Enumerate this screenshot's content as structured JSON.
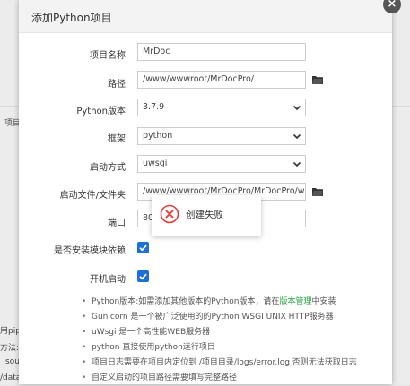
{
  "background": {
    "left_texts": [
      "项目",
      "用pip",
      "方法:",
      "sou",
      "/data"
    ]
  },
  "modal": {
    "title": "添加Python项目",
    "close_icon": "close-icon"
  },
  "form": {
    "project_name": {
      "label": "项目名称",
      "value": "MrDoc"
    },
    "path": {
      "label": "路径",
      "value": "/www/wwwroot/MrDocPro/"
    },
    "python_version": {
      "label": "Python版本",
      "value": "3.7.9"
    },
    "framework": {
      "label": "框架",
      "value": "python"
    },
    "start_method": {
      "label": "启动方式",
      "value": "uwsgi"
    },
    "start_file": {
      "label": "启动文件/文件夹",
      "value": "/www/wwwroot/MrDocPro/MrDocPro/wsgi.py"
    },
    "port": {
      "label": "端口",
      "value": "80"
    },
    "install_modules": {
      "label": "是否安装模块依赖",
      "checked": true
    },
    "autostart": {
      "label": "开机启动",
      "checked": true
    }
  },
  "tips": [
    {
      "before": "Python版本:如需添加其他版本的Python版本，请在",
      "link": "版本管理",
      "after": "中安装"
    },
    {
      "before": "Gunicorn 是一个被广泛使用的的Python WSGI UNIX HTTP服务器",
      "link": "",
      "after": ""
    },
    {
      "before": "uWsgi 是一个高性能WEB服务器",
      "link": "",
      "after": ""
    },
    {
      "before": "python 直接使用python运行项目",
      "link": "",
      "after": ""
    },
    {
      "before": "项目日志需要在项目内定位到 /项目目录/logs/error.log 否则无法获取日志",
      "link": "",
      "after": ""
    },
    {
      "before": "自定义启动的项目路径需要填写完整路径",
      "link": "",
      "after": ""
    }
  ],
  "toast": {
    "message": "创建失败",
    "icon": "error-circle-icon"
  },
  "colors": {
    "accent": "#1e6fd9",
    "link": "#20a53a",
    "error": "#e53935"
  }
}
